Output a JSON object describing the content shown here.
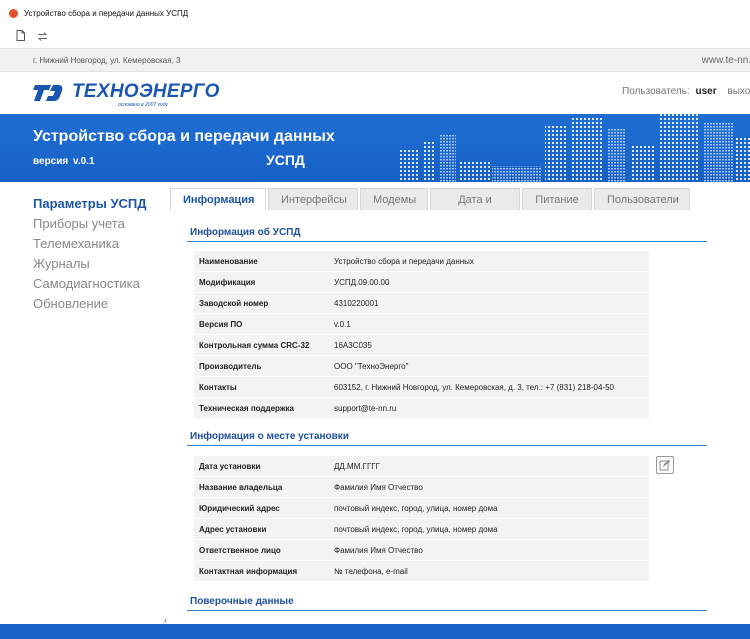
{
  "browser": {
    "tab_title": "Устройство сбора и передачи данных УСПД",
    "address_left": "г. Нижний Новгород, ул. Кемеровская, 3",
    "address_url": "www.te-nn.ru"
  },
  "header": {
    "logo_text": "ТЕХНОЭНЕРГО",
    "logo_sub": "основано в 2007 году",
    "user_label": "Пользователь:",
    "user_name": "user",
    "logout": "выход"
  },
  "banner": {
    "title": "Устройство сбора и передачи данных",
    "version_label": "версия",
    "version": "v.0.1",
    "short": "УСПД"
  },
  "nav": {
    "items": [
      "Параметры УСПД",
      "Приборы учета",
      "Телемеханика",
      "Журналы",
      "Самодиагностика",
      "Обновление"
    ]
  },
  "tabs": [
    "Информация",
    "Интерфейсы",
    "Модемы",
    "Дата и время",
    "Питание",
    "Пользователи"
  ],
  "info": {
    "title": "Информация об УСПД",
    "rows": [
      {
        "k": "Наименование",
        "v": "Устройство сбора и передачи данных"
      },
      {
        "k": "Модификация",
        "v": "УСПД.09.00.00"
      },
      {
        "k": "Заводской номер",
        "v": "4310220001"
      },
      {
        "k": "Версия ПО",
        "v": "v.0.1"
      },
      {
        "k": "Контрольная сумма CRC-32",
        "v": "16A3C035"
      },
      {
        "k": "Производитель",
        "v": "ООО \"ТехноЭнерго\""
      },
      {
        "k": "Контакты",
        "v": "603152, г. Нижний Новгород, ул. Кемеровская, д. 3, тел.: +7 (831) 218-04-50"
      },
      {
        "k": "Техническая поддержка",
        "v": "support@te-nn.ru"
      }
    ]
  },
  "install": {
    "title": "Информация о месте установки",
    "rows": [
      {
        "k": "Дата установки",
        "v": "ДД.ММ.ГГГГ"
      },
      {
        "k": "Название владельца",
        "v": "Фамилия Имя Отчество"
      },
      {
        "k": "Юридический адрес",
        "v": "почтовый индекс, город, улица, номер дома"
      },
      {
        "k": "Адрес установки",
        "v": "почтовый индекс, город, улица, номер дома"
      },
      {
        "k": "Ответственное лицо",
        "v": "Фамилия Имя Отчество"
      },
      {
        "k": "Контактная информация",
        "v": "№ телефона, e-mail"
      }
    ]
  },
  "verification": {
    "title": "Поверочные данные"
  },
  "colors": {
    "brand_blue": "#1f6fd3",
    "title_blue": "#1d4f9c"
  }
}
